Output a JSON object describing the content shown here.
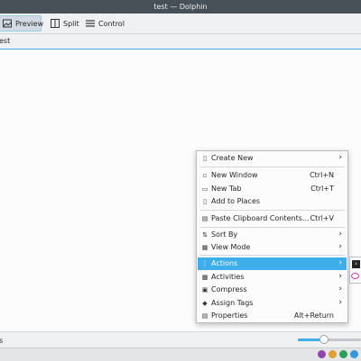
{
  "window": {
    "title": "test — Dolphin"
  },
  "toolbar": {
    "buttons": [
      {
        "label": "Preview",
        "icon": "image-icon",
        "active": true
      },
      {
        "label": "Split",
        "icon": "split-icon",
        "active": false
      },
      {
        "label": "Control",
        "icon": "hamburger-menu-icon",
        "active": false
      }
    ]
  },
  "location": {
    "text": "est"
  },
  "statusbar": {
    "text": "s",
    "zoom_fraction": 0.4
  },
  "context_menu": {
    "items": [
      {
        "label": "Create New",
        "icon": "document-new-icon",
        "shortcut": "",
        "submenu": true
      },
      {
        "label": "New Window",
        "icon": "window-new-icon",
        "shortcut": "Ctrl+N",
        "submenu": false
      },
      {
        "label": "New Tab",
        "icon": "tab-new-icon",
        "shortcut": "Ctrl+T",
        "submenu": false
      },
      {
        "label": "Add to Places",
        "icon": "bookmark-new-icon",
        "shortcut": "",
        "submenu": false
      },
      {
        "label": "Paste Clipboard Contents...",
        "icon": "edit-paste-icon",
        "shortcut": "Ctrl+V",
        "submenu": false
      },
      {
        "label": "Sort By",
        "icon": "sort-icon",
        "shortcut": "",
        "submenu": true
      },
      {
        "label": "View Mode",
        "icon": "view-mode-icon",
        "shortcut": "",
        "submenu": true
      },
      {
        "label": "Actions",
        "icon": "actions-icon",
        "shortcut": "",
        "submenu": true,
        "highlighted": true
      },
      {
        "label": "Activities",
        "icon": "activities-icon",
        "shortcut": "",
        "submenu": true
      },
      {
        "label": "Compress",
        "icon": "archive-icon",
        "shortcut": "",
        "submenu": true
      },
      {
        "label": "Assign Tags",
        "icon": "tag-icon",
        "shortcut": "",
        "submenu": true
      },
      {
        "label": "Properties",
        "icon": "properties-icon",
        "shortcut": "Alt+Return",
        "submenu": false
      }
    ]
  },
  "colors": {
    "accent": "#3daee9",
    "titlebar": "#475057",
    "menu_bg": "#fcfcfc"
  }
}
